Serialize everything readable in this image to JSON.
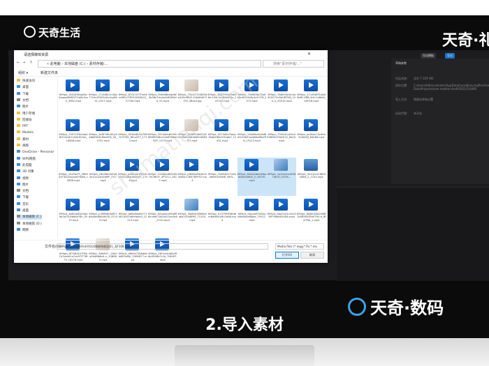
{
  "watermark_top": "天奇生活",
  "brand_right": "天奇·礼",
  "brand_bottom": "天奇·数码",
  "subtitle": "2.导入素材",
  "diagonal_watermark": "shumatianqi.com",
  "dialog": {
    "title": "请选择媒体资源",
    "address": "« 此电脑 › 本地磁盘 (C:) › 素材存储/...",
    "search_placeholder": "搜索\"素材存储/...\"",
    "toolbar_left": "组织 ▾",
    "toolbar_mid": "新建文件夹",
    "sidebar_items": [
      {
        "label": "快速访问",
        "color": "#f0c040"
      },
      {
        "label": "桌面",
        "color": "#3d8ee0"
      },
      {
        "label": "下载",
        "color": "#3d8ee0"
      },
      {
        "label": "文档",
        "color": "#888888"
      },
      {
        "label": "图片",
        "color": "#3d8ee0"
      },
      {
        "label": "用户存储",
        "color": "#f0c040"
      },
      {
        "label": "回收站",
        "color": "#f0c040"
      },
      {
        "label": "PPT",
        "color": "#f0c040"
      },
      {
        "label": "Models",
        "color": "#f0c040"
      },
      {
        "label": "素材",
        "color": "#f0c040"
      },
      {
        "label": "视频",
        "color": "#f0c040"
      },
      {
        "label": "OneDrive - Personal",
        "color": "#3d8ee0"
      },
      {
        "label": "WPS网盘",
        "color": "#3d8ee0"
      },
      {
        "label": "此电脑",
        "color": "#3d8ee0"
      },
      {
        "label": "3D 对象",
        "color": "#3d8ee0"
      },
      {
        "label": "视频",
        "color": "#3d8ee0"
      },
      {
        "label": "图片",
        "color": "#3d8ee0"
      },
      {
        "label": "文档",
        "color": "#888888"
      },
      {
        "label": "下载",
        "color": "#3d8ee0"
      },
      {
        "label": "音乐",
        "color": "#3d8ee0"
      },
      {
        "label": "桌面",
        "color": "#3d8ee0"
      },
      {
        "label": "本地磁盘 (C:)",
        "color": "#888888"
      },
      {
        "label": "本地磁盘 (D:)",
        "color": "#888888"
      },
      {
        "label": "网络",
        "color": "#3d8ee0"
      }
    ],
    "files": [
      {
        "name": "699pic_0I4SKY8ep0NvXzqawAW82Z7cbBc5xs0_3962.mp4",
        "kind": "video"
      },
      {
        "name": "699pic_17vk4BCm3Zjz77Lfm4YW5cfdc4uyB0Gf_2527.mp4",
        "kind": "video"
      },
      {
        "name": "699pic_B7OO1Y7Fmk6ur8fSLCFR9f.2069iJ1Z_57784.mp4",
        "kind": "video"
      },
      {
        "name": "699pic_I9Hf4f8b5qbNF0b58e7dc0aAh8QM4aG_91.mp4",
        "kind": "video"
      },
      {
        "name": "699pic_7924I7130B3f4p3Gfe5B92.2h6aRd97f3Y0_3Bas4.jpg",
        "kind": "photo"
      },
      {
        "name": "699pic_3687f95u09dfZ6e.2i5d.2b2B0d5t3x_223702.mp4",
        "kind": "video"
      },
      {
        "name": "699pic_7096Ef4b70aEb5rdD3.6sRy3uFcT9f_2572.mp4",
        "kind": "video"
      },
      {
        "name": "699pic_7865Y8cVm2a6C0Z7nd3aUBT4M_10U_0_53510.mp4",
        "kind": "video"
      },
      {
        "name": "699pic_371956Ff5uNU5bf6.1f68_4d1r1zBdfd_4HF48.mp4",
        "kind": "video"
      },
      {
        "name": "699pic_7057255b2ab4fbTmhQb7vh0bfS.Fa0_16648.mp4",
        "kind": "video"
      },
      {
        "name": "699pic_3a8F.9f0d0Cp5A6bE6S4hf0bt5l9J_3X_3752.mp4",
        "kind": "video"
      },
      {
        "name": "699pic_3E3Ad8c5A7f8f7nFt7B1_8Ecz0F7_1773.mp4",
        "kind": "video"
      },
      {
        "name": "699pic_3914ddrd87f9h6B9f8Fd6c0c0e6T66d0B2F_1373.mp4",
        "kind": "video"
      },
      {
        "name": "699pic_506f91dfd514fb5ZRd91b64b0B7aBE0D7.mp4",
        "kind": "photo"
      },
      {
        "name": "699pic_5073d5a7bdpr1Bbb5f6fcft7tvbb7_12431.mp4",
        "kind": "video"
      },
      {
        "name": "699pic_136d9ba5u6d8ef2G9b52w4b8b08b2P8_15123.mp4",
        "kind": "video"
      },
      {
        "name": "699pic_7590d1Lb5fc4K0BftEd75bfU1Z_8443.mp4",
        "kind": "video"
      },
      {
        "name": "699pic_ac8hecC3cdHn5L8hf4fJ_84b88.mp4",
        "kind": "video"
      },
      {
        "name": "699pic_x3x0arFF_9f60f43T3D2cbcbad7fD6e_15838.mp4",
        "kind": "video"
      },
      {
        "name": "699pic_cBv9f6x3eFe8wU1u02o3ZdMF_2Y2.mp4",
        "kind": "video"
      },
      {
        "name": "699pic_p4f9n4e1Mdsf1VG5LcaBsDwf3Vf7_2756.mp4",
        "kind": "video"
      },
      {
        "name": "699pic_n54WLb8t52Eb70Cf6mF_3PTV11_2627.mp4",
        "kind": "video"
      },
      {
        "name": "699pic_pf84Bu8fe4bCh4xf6A.n2B47B9F52.mp4",
        "kind": "video"
      },
      {
        "name": "699pic_3a6S4ktr7nDedbfbF.6o5WB_58f3...",
        "kind": "video"
      },
      {
        "name": "699pic_8xhlb4dbelkfbpd0N44e6d4_5_05035.mp4",
        "kind": "video"
      },
      {
        "name": "699pic_1a4mfcbxhf0DGfb0f_1S53s...",
        "kind": "pic2"
      },
      {
        "name": "699pic_3e1Q0u2r6B3fD8h8_2_1203.mp4",
        "kind": "film"
      },
      {
        "name": "699pic_ba8mp6Qe5b4bb3xF3u5b6ba76h_3570.mp4",
        "kind": "video"
      },
      {
        "name": "699pic_Ju9f6b8r8xRF2b4d4bd6b0Hb7R_37149.mp4",
        "kind": "video"
      },
      {
        "name": "699pic_b86oMeafb771k87d2d7a8e9b4b3_12319.mp4",
        "kind": "video"
      },
      {
        "name": "699pic_8Auoeen09b6Rbhue6h7Ai0rJiI23nc0b8_2120.mp4",
        "kind": "video"
      },
      {
        "name": "699pic_i0b6f4cSB64b0aKa25UaRfMF_71203.mp4",
        "kind": "pic2"
      },
      {
        "name": "699pic_b13796fF8Bd6mBafBh4yRLGo6B.mp4",
        "kind": "video"
      },
      {
        "name": "699pic_dlacxbB7e8GabBh6B4a88Jea_79312.mp4",
        "kind": "video"
      },
      {
        "name": "699pic_bbaOsVsu2hu5fHFY6bb8t1dDA.mp4",
        "kind": "video"
      },
      {
        "name": "699pic_8b8b1f8b29dfB1b5B5t4GRb0TH0-b_fBj37Bb_1.mp4",
        "kind": "video"
      },
      {
        "name": "699pic_6f7b8d1x7F6b7b7da4d1a7nb5TfT7BfT9_18278.mp4",
        "kind": "video"
      },
      {
        "name": "699pic_38b9d7...2fiaOd4b4Bb6b6..n_33BB85.mp4",
        "kind": "photo"
      },
      {
        "name": "699pic_48e9d72b6dbbb6B7b6fh_7HB4B77.mp4",
        "kind": "video"
      },
      {
        "name": "699pic_28f1dr4dd0b9f6b0D06b7c1b_7HB4f7.mp4",
        "kind": "video"
      }
    ],
    "filename_label": "文件名(N):",
    "filename_value": "699pic_8dHaBk9c4r0t3cD8b0hdk1c01_3JF30B.mp4\"",
    "filetype_value": "Media files (*.mpg;*.flv;*.mo",
    "open_button": "打开(O)",
    "cancel_button": "取消"
  },
  "editor": {
    "btn_a": "导出模板",
    "btn_b": "导出",
    "panel_title": "草稿参数",
    "rows": [
      {
        "label": "作品名称:",
        "value": "北京 T 1OF HD"
      },
      {
        "label": "保存位置:",
        "value": "C:/Users/Administrator/AppData/Local/JianyingPro/User Data/Projects/com.lveditor.draft/2021/1/4/HD"
      },
      {
        "label": "导入方式:",
        "value": "保留在原有位置"
      },
      {
        "label": "自动代理:",
        "value": "未开启"
      }
    ]
  }
}
